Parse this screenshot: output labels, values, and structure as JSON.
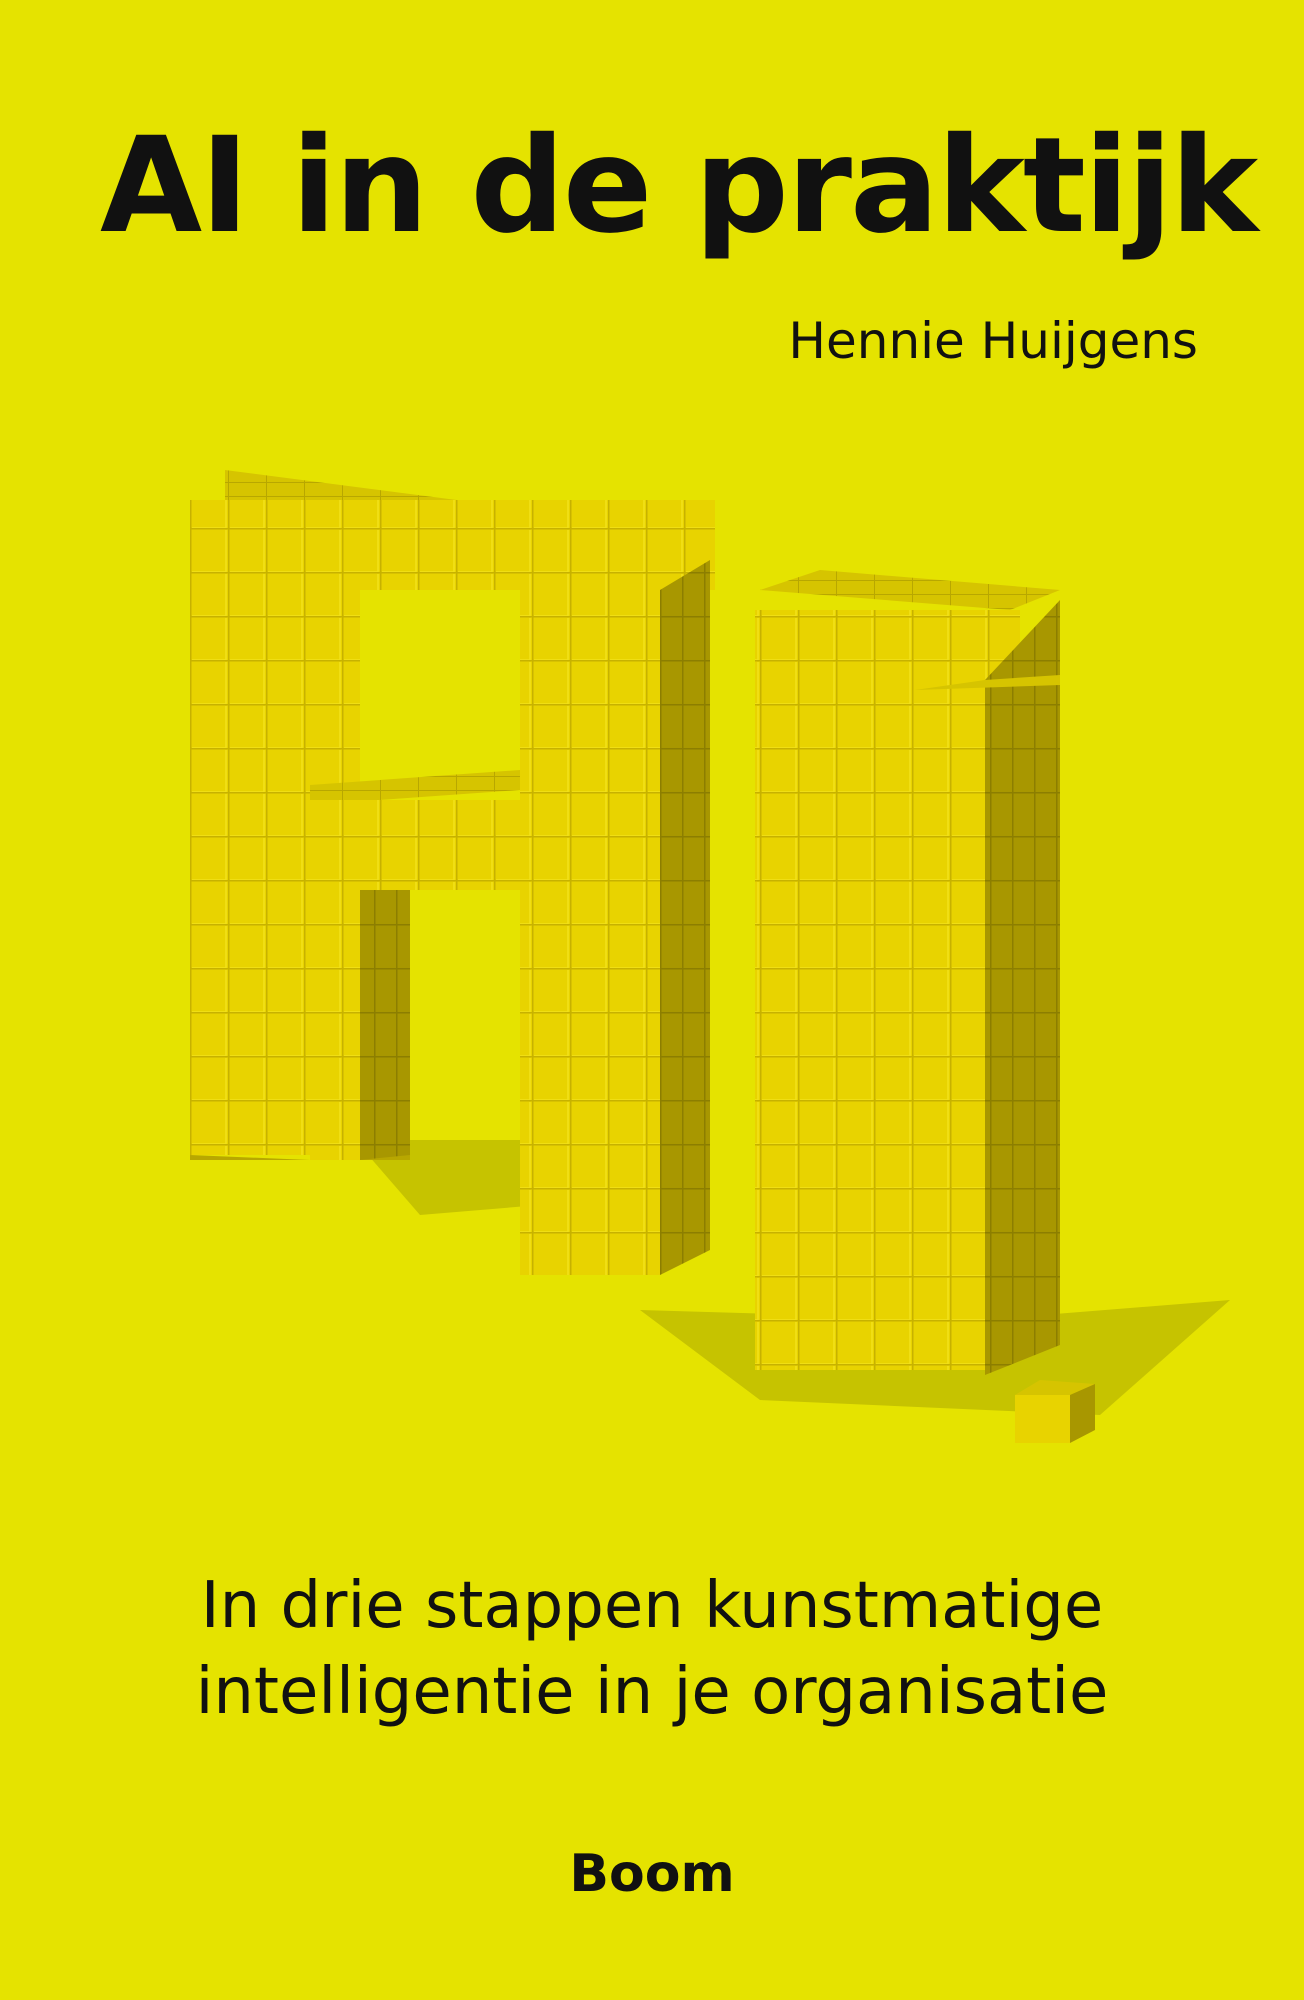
{
  "cover": {
    "title": "AI in de praktijk",
    "author": "Hennie Huijgens",
    "subtitle_line1": "In drie stappen kunstmatige",
    "subtitle_line2": "intelligentie in je organisatie",
    "publisher": "Boom"
  },
  "colors": {
    "background": "#e5e300",
    "text": "#111111",
    "cube_front": "#e8d300",
    "cube_side": "#a89700",
    "cube_top": "#d6c400",
    "shadow": "#c6c300"
  },
  "illustration": {
    "subject": "letters AI built from stacked cubes",
    "icon": "cube-letters-ai-icon"
  }
}
